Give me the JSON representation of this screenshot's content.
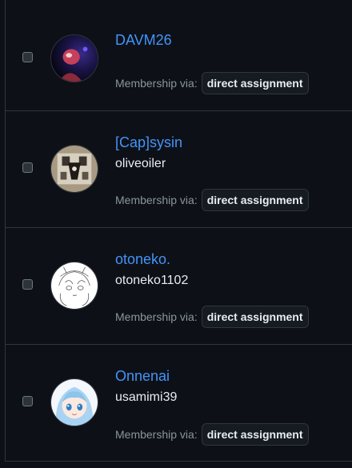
{
  "members": [
    {
      "display_name": "DAVM26",
      "login": "",
      "membership_label": "Membership via:",
      "membership_value": "direct assignment",
      "avatar": "davm26-avatar"
    },
    {
      "display_name": "[Cap]sysin",
      "login": "oliveoiler",
      "membership_label": "Membership via:",
      "membership_value": "direct assignment",
      "avatar": "capsysin-avatar"
    },
    {
      "display_name": "otoneko.",
      "login": "otoneko1102",
      "membership_label": "Membership via:",
      "membership_value": "direct assignment",
      "avatar": "otoneko-avatar"
    },
    {
      "display_name": "Onnenai",
      "login": "usamimi39",
      "membership_label": "Membership via:",
      "membership_value": "direct assignment",
      "avatar": "onnenai-avatar"
    }
  ],
  "colors": {
    "background": "#0d1117",
    "border": "#30363d",
    "link": "#4493f8",
    "muted": "#8b949e",
    "text": "#e6edf3"
  }
}
